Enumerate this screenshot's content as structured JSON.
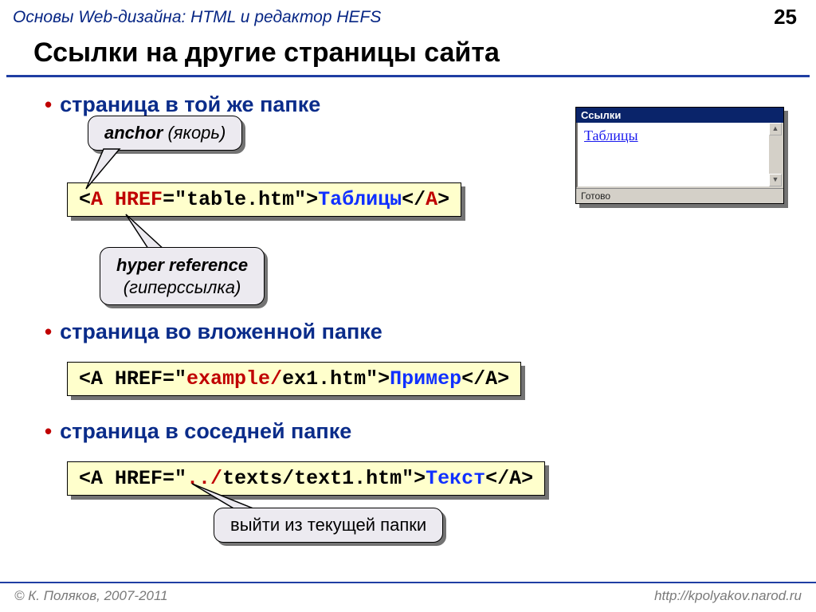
{
  "header": {
    "title": "Основы Web-дизайна: HTML и редактор HEFS",
    "page_number": "25"
  },
  "title": "Ссылки на другие страницы сайта",
  "sections": [
    {
      "bullet": "страница в той же папке",
      "callout1": {
        "bold": "anchor",
        "rest": " (якорь)"
      },
      "callout2": {
        "bold": "hyper reference",
        "rest": "(гиперссылка)"
      },
      "code": {
        "open": "<",
        "tag": "A",
        "sp1": " ",
        "attr": "HREF",
        "eq": "=\"table.htm\">",
        "linktext": "Таблицы",
        "close1": "</",
        "close_tag": "A",
        "close2": ">"
      }
    },
    {
      "bullet": "страница во вложенной папке",
      "code": {
        "open": "<",
        "tag": "A HREF",
        "eq": "=\"",
        "path": "example/",
        "file": "ex1.htm\">",
        "linktext": "Пример",
        "close": "</A>"
      }
    },
    {
      "bullet": "страница в соседней папке",
      "code": {
        "open": "<",
        "tag": "A HREF",
        "eq": "=\"",
        "path": "../",
        "file": "texts/text1.htm\">",
        "linktext": "Текст",
        "close": "</A>"
      },
      "callout": "выйти из текущей папки"
    }
  ],
  "browser": {
    "title": "Ссылки",
    "link": "Таблицы",
    "status": "Готово"
  },
  "footer": {
    "left": "© К. Поляков, 2007-2011",
    "right": "http://kpolyakov.narod.ru"
  }
}
